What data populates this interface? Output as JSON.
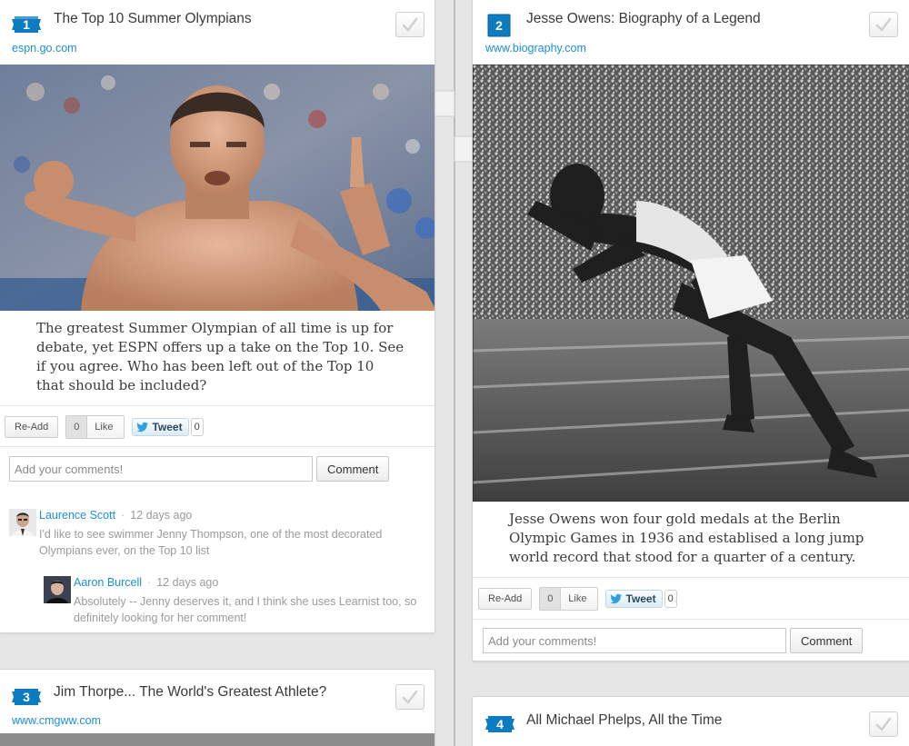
{
  "colors": {
    "accent": "#1d8fd3",
    "badge": "#0d7bbf",
    "spine": "#bdbdbd"
  },
  "cards": [
    {
      "number": "1",
      "title": "The Top 10 Summer Olympians",
      "source": "espn.go.com",
      "description": "The greatest Summer Olympian of all time is up for debate, yet ESPN offers up a take on the Top 10. See if you agree. Who has been left out of the Top 10 that should be included?",
      "readd_label": "Re-Add",
      "like_count": "0",
      "like_label": "Like",
      "tweet_label": "Tweet",
      "tweet_count": "0",
      "comment_placeholder": "Add your comments!",
      "comment_button": "Comment",
      "comments": [
        {
          "author": "Laurence Scott",
          "time": "12 days ago",
          "text": "I'd like to see swimmer Jenny Thompson, one of the most decorated Olympians ever, on the Top 10 list"
        },
        {
          "author": "Aaron Burcell",
          "time": "12 days ago",
          "text": "Absolutely -- Jenny deserves it, and I think she uses Learnist too, so definitely looking for her comment!"
        }
      ]
    },
    {
      "number": "2",
      "title": "Jesse Owens: Biography of a Legend",
      "source": "www.biography.com",
      "description": "Jesse Owens won four gold medals at the Berlin Olympic Games in 1936 and establised a long jump world record that stood for a quarter of a century.",
      "readd_label": "Re-Add",
      "like_count": "0",
      "like_label": "Like",
      "tweet_label": "Tweet",
      "tweet_count": "0",
      "comment_placeholder": "Add your comments!",
      "comment_button": "Comment"
    },
    {
      "number": "3",
      "title": "Jim Thorpe... The World's Greatest Athlete?",
      "source": "www.cmgww.com"
    },
    {
      "number": "4",
      "title": "All Michael Phelps, All the Time"
    }
  ]
}
